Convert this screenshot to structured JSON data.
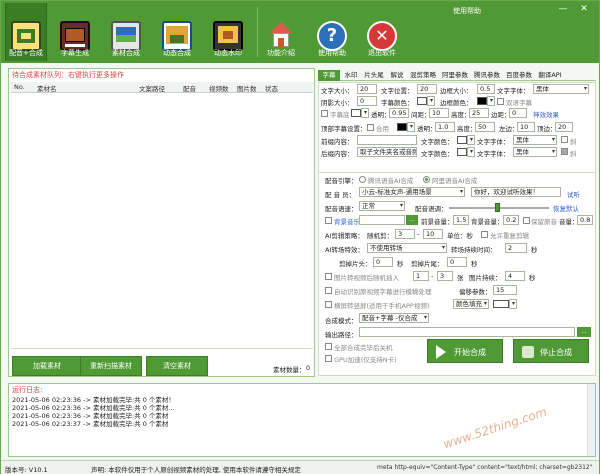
{
  "window": {
    "help_label": "使用帮助",
    "minimize": "—",
    "close": "✕"
  },
  "toolbar": [
    {
      "label": "配音+合成",
      "active": true,
      "icon": "film-edit-icon",
      "color": "#ffe07a"
    },
    {
      "label": "字幕生成",
      "icon": "subtitle-icon",
      "color": "#6a2b2b"
    },
    {
      "label": "素材合成",
      "icon": "tv-monitor-icon",
      "color": "#2c6fb8"
    },
    {
      "label": "动态合成",
      "icon": "motion-icon",
      "color": "#e0a830"
    },
    {
      "label": "动态水印",
      "icon": "watermark-icon",
      "color": "#f2c14e"
    },
    {
      "label": "功能介绍",
      "icon": "home-icon",
      "color": "#e05a4a"
    },
    {
      "label": "使用帮助",
      "icon": "help-icon",
      "color": "#2c6fb8"
    },
    {
      "label": "退出软件",
      "icon": "exit-icon",
      "color": "#d63838"
    }
  ],
  "queue": {
    "title": "待合成素材队列：右键执行更多操作",
    "columns": [
      "No.",
      "素材名",
      "文案路径",
      "配音",
      "视频数",
      "图片数",
      "状态"
    ],
    "count_label": "素材数量：",
    "count": "0",
    "buttons": {
      "load": "加载素材",
      "rescan": "重新扫描素材",
      "clear": "清空素材"
    }
  },
  "settings": {
    "tabs": [
      "字幕",
      "水印",
      "片头尾",
      "解说",
      "混剪策略",
      "阿里参数",
      "腾讯参数",
      "百度参数",
      "翻译API"
    ],
    "subtitle": {
      "font_size_label": "文字大小：",
      "font_size": "20",
      "text_pos_label": "文字位置：",
      "text_pos": "20",
      "border_size_label": "边框大小：",
      "border_size": "0.5",
      "font_label": "文字字体：",
      "font": "黑体",
      "shadow_label": "阴影大小：",
      "shadow": "0",
      "color_label": "字幕颜色：",
      "border_color_label": "边框颜色：",
      "bilingual_label": "双语字幕",
      "bg_label": "字幕底",
      "alpha_label": "透明：",
      "alpha": "0.95",
      "margin_label": "间距：",
      "margin": "10",
      "height_label": "高度：",
      "height": "25",
      "edge_label": "边距：",
      "edge": "0",
      "effect_link": "神效效果",
      "top_label": "顶部字幕设置：",
      "merge_label": "合用",
      "top_alpha": "1.0",
      "top_height": "50",
      "left_label": "左边：",
      "left": "10",
      "topm_label": "顶边：",
      "topm": "20",
      "front_label": "前缀内容：",
      "text_color_label": "文字颜色：",
      "text_font_label": "文字字体：",
      "front_font": "黑体",
      "back_label": "后缀内容：",
      "back_value": "取子文件夹名或音频",
      "back_font": "黑体",
      "slant_label": "斜"
    },
    "voice": {
      "engine_label": "配音引擎：",
      "engine_a": "腾讯语音AI合成",
      "engine_b": "阿里语音AI合成",
      "speaker_label": "配 音 员：",
      "speaker": "小云-标准女声-通用场景",
      "test_text": "你好，欢迎试听效果！",
      "listen_link": "试听",
      "speed_label": "配音语速：",
      "speed": "正常",
      "tone_label": "配音语调：",
      "restore_link": "恢复默认",
      "bgm_label": "背景音乐",
      "bgm_btn": "...",
      "fg_vol_label": "前景音量：",
      "fg_vol": "1.5",
      "bg_vol_label": "背景音量：",
      "bg_vol": "0.2",
      "keep_label": "保留原音",
      "vol_label": "音量：",
      "vol": "0.8",
      "ai_cut_label": "AI剪辑策略：",
      "random_label": "随机剪：",
      "random_from": "3",
      "random_to": "10",
      "unit_label": "单位：秒",
      "allow_label": "允许重复剪辑",
      "transition_label": "AI转场特效：",
      "transition": "不使用转场",
      "trans_time_label": "转场持续时间：",
      "trans_time": "2",
      "unit_sec": "秒",
      "cut_head_label": "剪掉片头：",
      "cut_head": "0",
      "cut_tail_label": "剪掉片尾：",
      "cut_tail": "0",
      "img_insert_label": "图片转视频后随机插入",
      "img_from": "1",
      "img_to": "3",
      "img_unit": "张",
      "img_dur_label": "图片持续：",
      "img_dur": "4",
      "auto_detect_label": "自动识别原视频字幕进行模糊处理",
      "offset_label": "偏移参数：",
      "offset": "15",
      "landscape_label": "横屏转竖屏(适用于手机APP视频)",
      "fill_label": "颜色填充",
      "mode_label": "合成模式：",
      "mode": "配音+字幕 -仅合成",
      "output_label": "输出路径：",
      "output_btn": "...",
      "shutdown_label": "全部合成完毕后关机",
      "gpu_label": "GPU加速(仅支持N卡)",
      "start_label": "开始合成",
      "stop_label": "停止合成"
    }
  },
  "log": {
    "title": "运行日志:",
    "lines": [
      "2021-05-06 02:23:36 ->  素材加载完毕:共 0 个素材！",
      "2021-05-06 02:23:36 ->  素材加载完毕:共 0 个素材...",
      "2021-05-06 02:23:36 -> 素材加载完毕:共 0 个素材",
      "2021-05-06 02:23:37 -> 素材加载完毕:共 0 个素材"
    ]
  },
  "status": {
    "version": "版本号: V10.1",
    "notice": "声明: 本软件仅用于个人原创视频素材的处理, 使用本软件请遵守相关规定",
    "meta": "meta http-equiv=\"Content-Type\" content=\"text/html; charset=gb2312\""
  },
  "watermark": "www.52thing.com"
}
